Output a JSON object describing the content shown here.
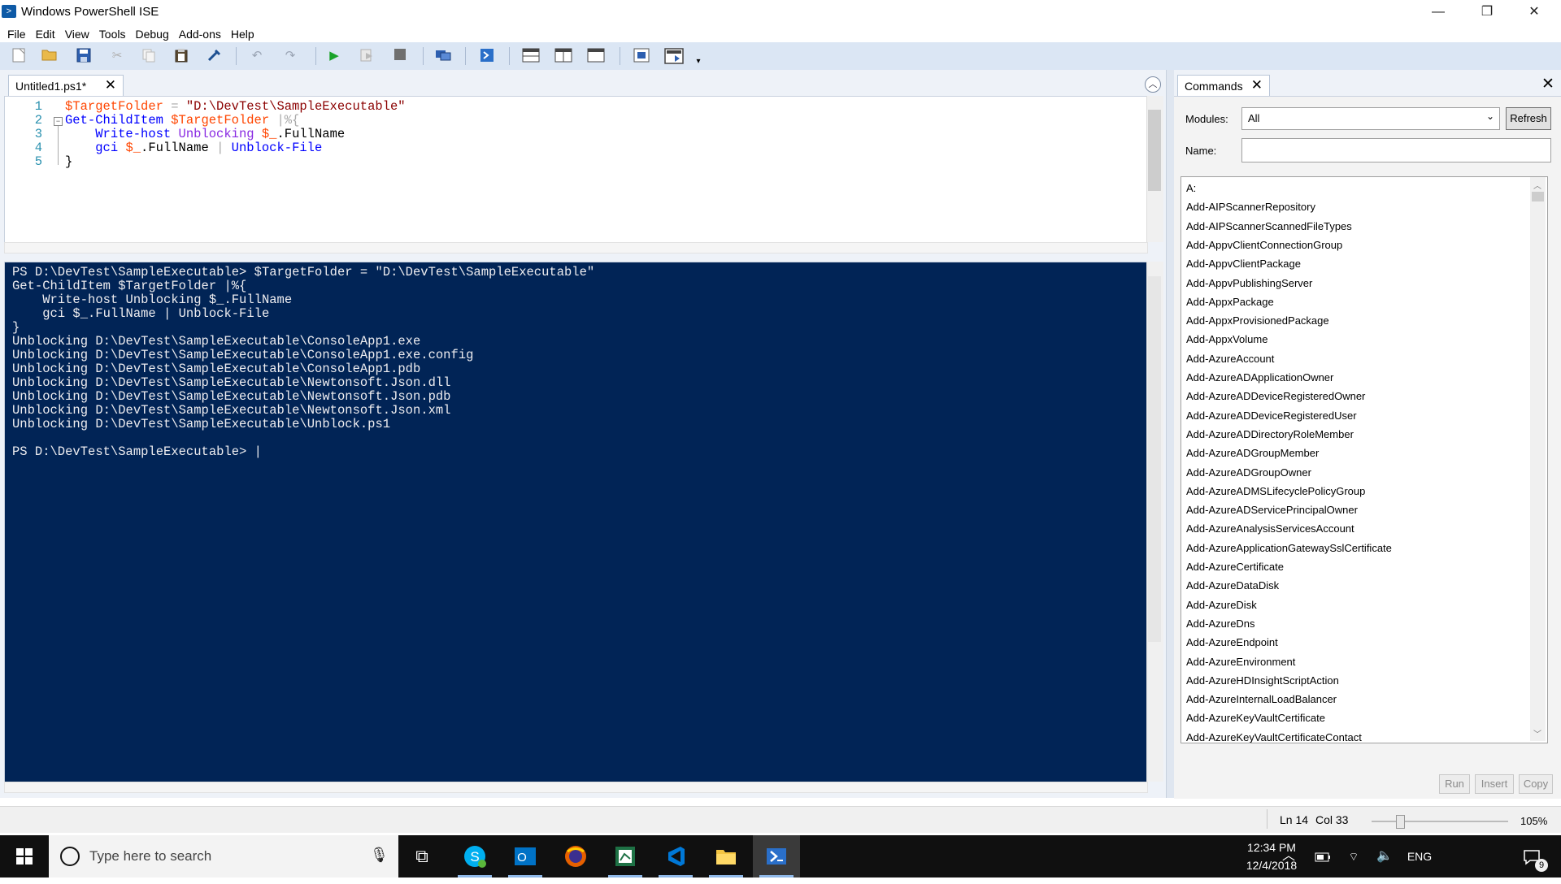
{
  "window": {
    "title": "Windows PowerShell ISE",
    "minimize": "—",
    "restore": "❐",
    "close": "✕"
  },
  "menu": [
    "File",
    "Edit",
    "View",
    "Tools",
    "Debug",
    "Add-ons",
    "Help"
  ],
  "toolbar_icons": [
    "new-icon",
    "open-icon",
    "save-icon",
    "cut-icon",
    "copy-icon",
    "paste-icon",
    "clear-icon",
    "undo-icon",
    "redo-icon",
    "run-icon",
    "run-selection-icon",
    "stop-icon",
    "remote-icon",
    "powershell-icon",
    "layout-top-icon",
    "layout-right-icon",
    "layout-max-icon",
    "show-script-icon",
    "show-commands-icon"
  ],
  "editor": {
    "tab_label": "Untitled1.ps1*",
    "tab_close": "✕",
    "line_numbers": [
      "1",
      "2",
      "3",
      "4",
      "5"
    ],
    "lines": [
      {
        "tokens": [
          {
            "t": "$TargetFolder",
            "c": "var"
          },
          {
            "t": " = ",
            "c": "op"
          },
          {
            "t": "\"D:\\DevTest\\SampleExecutable\"",
            "c": "str"
          }
        ]
      },
      {
        "tokens": [
          {
            "t": "Get-ChildItem",
            "c": "cmd"
          },
          {
            "t": " ",
            "c": "plain"
          },
          {
            "t": "$TargetFolder",
            "c": "var"
          },
          {
            "t": " |%{",
            "c": "op"
          }
        ]
      },
      {
        "tokens": [
          {
            "t": "    ",
            "c": "plain"
          },
          {
            "t": "Write-host",
            "c": "cmd"
          },
          {
            "t": " Unblocking ",
            "c": "arg"
          },
          {
            "t": "$_",
            "c": "var"
          },
          {
            "t": ".FullName",
            "c": "prop"
          }
        ]
      },
      {
        "tokens": [
          {
            "t": "    ",
            "c": "plain"
          },
          {
            "t": "gci",
            "c": "cmd"
          },
          {
            "t": " ",
            "c": "plain"
          },
          {
            "t": "$_",
            "c": "var"
          },
          {
            "t": ".FullName",
            "c": "prop"
          },
          {
            "t": " | ",
            "c": "op"
          },
          {
            "t": "Unblock-File",
            "c": "cmd"
          }
        ]
      },
      {
        "tokens": [
          {
            "t": "}",
            "c": "plain"
          }
        ]
      }
    ]
  },
  "console": {
    "lines": [
      "PS D:\\DevTest\\SampleExecutable> $TargetFolder = \"D:\\DevTest\\SampleExecutable\"",
      "Get-ChildItem $TargetFolder |%{",
      "    Write-host Unblocking $_.FullName",
      "    gci $_.FullName | Unblock-File",
      "}",
      "Unblocking D:\\DevTest\\SampleExecutable\\ConsoleApp1.exe",
      "Unblocking D:\\DevTest\\SampleExecutable\\ConsoleApp1.exe.config",
      "Unblocking D:\\DevTest\\SampleExecutable\\ConsoleApp1.pdb",
      "Unblocking D:\\DevTest\\SampleExecutable\\Newtonsoft.Json.dll",
      "Unblocking D:\\DevTest\\SampleExecutable\\Newtonsoft.Json.pdb",
      "Unblocking D:\\DevTest\\SampleExecutable\\Newtonsoft.Json.xml",
      "Unblocking D:\\DevTest\\SampleExecutable\\Unblock.ps1",
      "",
      "PS D:\\DevTest\\SampleExecutable> |"
    ]
  },
  "commands_panel": {
    "tab_label": "Commands",
    "tab_close": "✕",
    "panel_close": "✕",
    "modules_label": "Modules:",
    "modules_value": "All",
    "refresh": "Refresh",
    "name_label": "Name:",
    "name_value": "",
    "items": [
      "A:",
      "Add-AIPScannerRepository",
      "Add-AIPScannerScannedFileTypes",
      "Add-AppvClientConnectionGroup",
      "Add-AppvClientPackage",
      "Add-AppvPublishingServer",
      "Add-AppxPackage",
      "Add-AppxProvisionedPackage",
      "Add-AppxVolume",
      "Add-AzureAccount",
      "Add-AzureADApplicationOwner",
      "Add-AzureADDeviceRegisteredOwner",
      "Add-AzureADDeviceRegisteredUser",
      "Add-AzureADDirectoryRoleMember",
      "Add-AzureADGroupMember",
      "Add-AzureADGroupOwner",
      "Add-AzureADMSLifecyclePolicyGroup",
      "Add-AzureADServicePrincipalOwner",
      "Add-AzureAnalysisServicesAccount",
      "Add-AzureApplicationGatewaySslCertificate",
      "Add-AzureCertificate",
      "Add-AzureDataDisk",
      "Add-AzureDisk",
      "Add-AzureDns",
      "Add-AzureEndpoint",
      "Add-AzureEnvironment",
      "Add-AzureHDInsightScriptAction",
      "Add-AzureInternalLoadBalancer",
      "Add-AzureKeyVaultCertificate",
      "Add-AzureKeyVaultCertificateContact"
    ],
    "run": "Run",
    "insert": "Insert",
    "copy": "Copy"
  },
  "status": {
    "ln": "Ln 14",
    "col": "Col 33",
    "zoom": "105%",
    "zoom_level_percent": 20
  },
  "taskbar": {
    "search_placeholder": "Type here to search",
    "apps": [
      "skype-icon",
      "outlook-icon",
      "firefox-icon",
      "spreadsheet-icon",
      "vscode-icon",
      "file-explorer-icon",
      "powershell-icon"
    ],
    "lang": "ENG",
    "time": "12:34 PM",
    "date": "12/4/2018",
    "notifications": "9"
  },
  "colors": {
    "console_bg": "#012456",
    "toolbar_bg": "#dbe6f4",
    "taskbar_bg": "#101010"
  }
}
